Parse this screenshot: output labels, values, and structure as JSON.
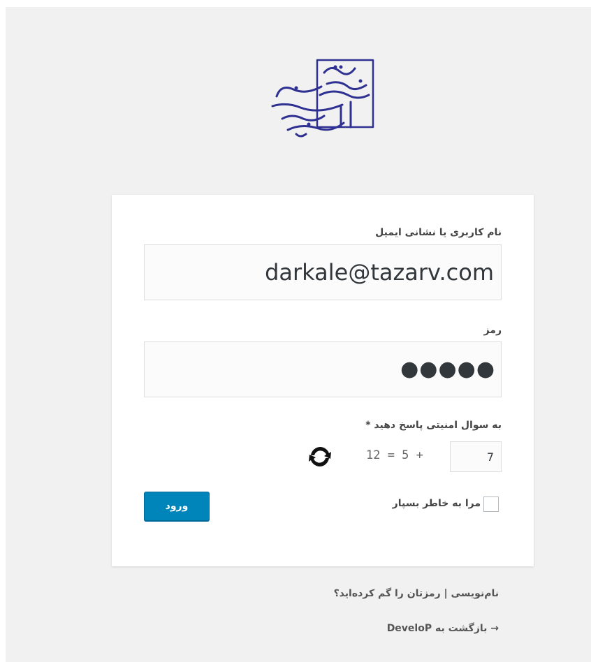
{
  "logo": {
    "icon": "organization-logo",
    "color": "#2e3192"
  },
  "form": {
    "username_label": "نام کاربری یا نشانی ایمیل",
    "username_value": "darkale@tazarv.com",
    "password_label": "رمز",
    "password_masked": "●●●●●",
    "captcha_label": "به سوال امنیتی پاسخ دهید *",
    "captcha_answer": "7",
    "captcha_question": "12 = 5 +",
    "refresh_icon": "refresh-icon",
    "remember_label": "مرا به خاطر بسپار",
    "login_label": "ورود"
  },
  "colors": {
    "accent": "#0085ba",
    "background": "#f1f1f1",
    "card": "#ffffff"
  },
  "footer": {
    "register_link": "نام‌نویسی",
    "separator": "|",
    "lost_password_link": "رمزتان را گم کرده‌اید؟",
    "back_link": "→ بازگشت به DeveloP"
  }
}
